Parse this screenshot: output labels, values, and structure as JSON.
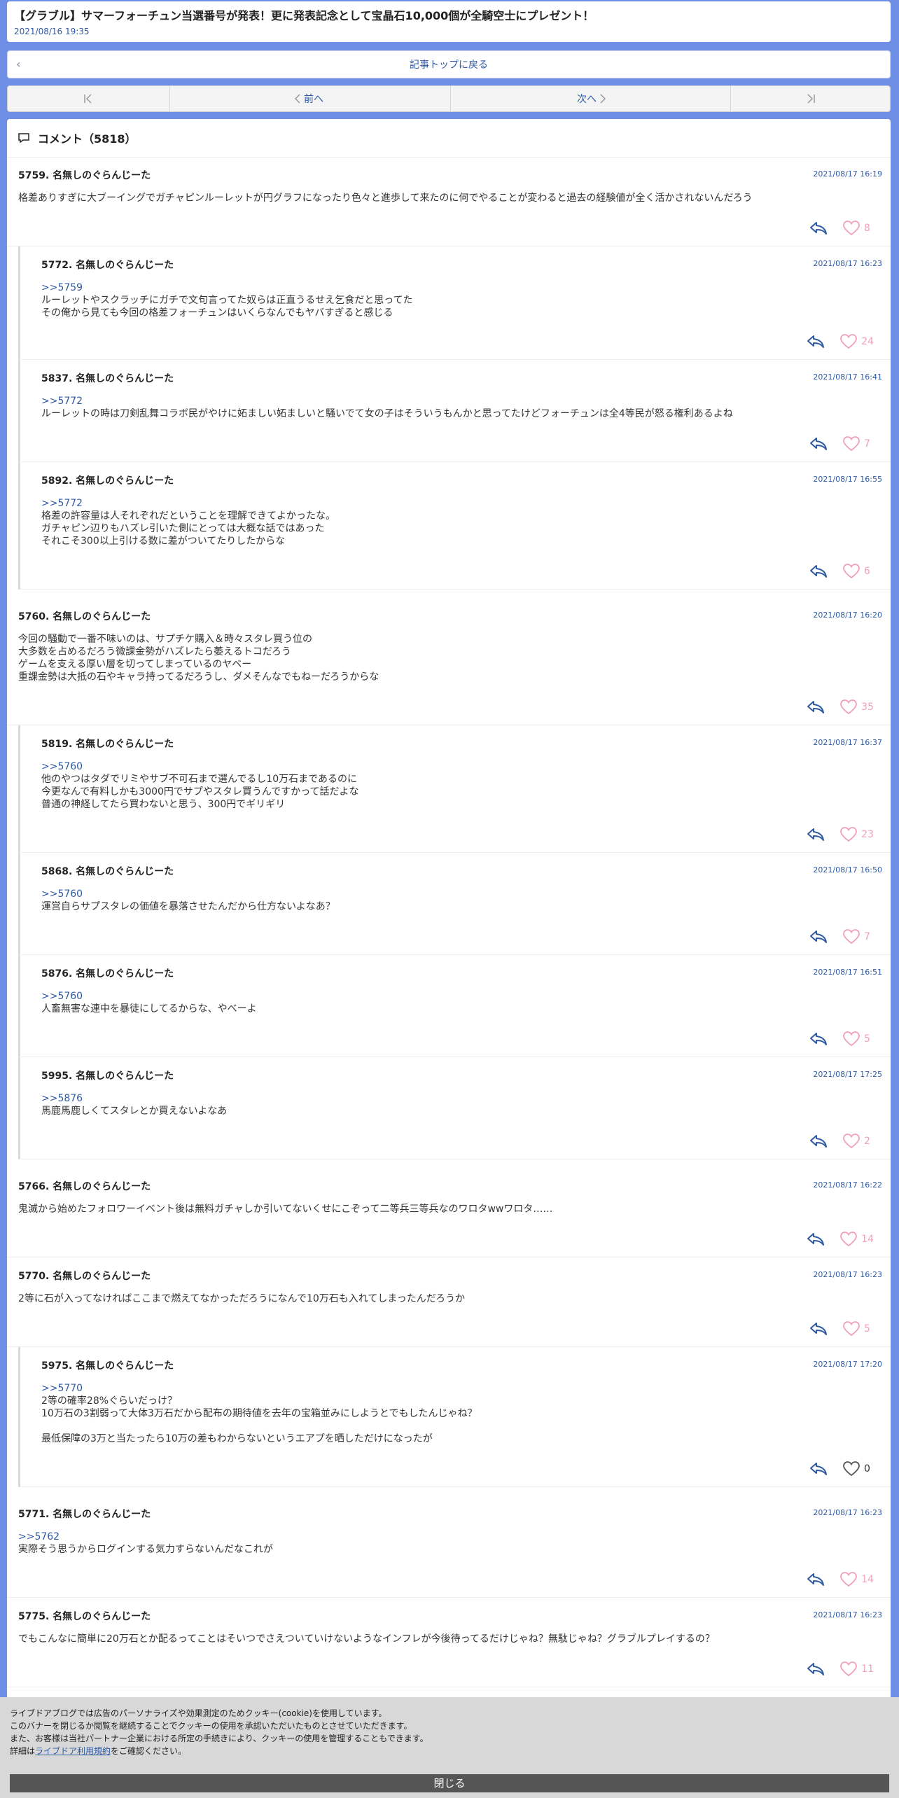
{
  "article": {
    "title": "【グラブル】サマーフォーチュン当選番号が発表！更に発表記念として宝晶石10,000個が全騎空士にプレゼント！",
    "date": "2021/08/16 19:35"
  },
  "back_label": "記事トップに戻る",
  "nav": {
    "prev": "前へ",
    "next": "次へ"
  },
  "comments_header": "コメント（5818）",
  "comments": [
    {
      "num": "5759.",
      "name": "名無しのぐらんじーた",
      "time": "2021/08/17 16:19",
      "anchor": "",
      "body": "格差ありすぎに大ブーイングでガチャピンルーレットが円グラフになったり色々と進歩して来たのに何でやることが変わると過去の経験値が全く活かされないんだろう",
      "likes": "8"
    },
    {
      "num": "5772.",
      "name": "名無しのぐらんじーた",
      "time": "2021/08/17 16:23",
      "anchor": ">>5759",
      "body": "ルーレットやスクラッチにガチで文句言ってた奴らは正直うるせえ乞食だと思ってた\nその俺から見ても今回の格差フォーチュンはいくらなんでもヤバすぎると感じる",
      "likes": "24"
    },
    {
      "num": "5837.",
      "name": "名無しのぐらんじーた",
      "time": "2021/08/17 16:41",
      "anchor": ">>5772",
      "body": "ルーレットの時は刀剣乱舞コラボ民がやけに妬ましい妬ましいと騒いでて女の子はそういうもんかと思ってたけどフォーチュンは全4等民が怒る権利あるよね",
      "likes": "7"
    },
    {
      "num": "5892.",
      "name": "名無しのぐらんじーた",
      "time": "2021/08/17 16:55",
      "anchor": ">>5772",
      "body": "格差の許容量は人それぞれだということを理解できてよかったな。\nガチャピン辺りもハズレ引いた側にとっては大概な話ではあった\nそれこそ300以上引ける数に差がついてたりしたからな",
      "likes": "6"
    },
    {
      "num": "5760.",
      "name": "名無しのぐらんじーた",
      "time": "2021/08/17 16:20",
      "anchor": "",
      "body": "今回の騒動で一番不味いのは、サプチケ購入＆時々スタレ買う位の\n大多数を占めるだろう微課金勢がハズレたら萎えるトコだろう\nゲームを支える厚い層を切ってしまっているのヤベー\n重課金勢は大抵の石やキャラ持ってるだろうし、ダメそんなでもねーだろうからな",
      "likes": "35"
    },
    {
      "num": "5819.",
      "name": "名無しのぐらんじーた",
      "time": "2021/08/17 16:37",
      "anchor": ">>5760",
      "body": "他のやつはタダでリミやサブ不可石まで選んでるし10万石まであるのに\n今更なんで有料しかも3000円でサプやスタレ買うんですかって話だよな\n普通の神経してたら買わないと思う、300円でギリギリ",
      "likes": "23"
    },
    {
      "num": "5868.",
      "name": "名無しのぐらんじーた",
      "time": "2021/08/17 16:50",
      "anchor": ">>5760",
      "body": "運営自らサプスタレの価値を暴落させたんだから仕方ないよなあ？",
      "likes": "7"
    },
    {
      "num": "5876.",
      "name": "名無しのぐらんじーた",
      "time": "2021/08/17 16:51",
      "anchor": ">>5760",
      "body": "人畜無害な連中を暴徒にしてるからな、やべーよ",
      "likes": "5"
    },
    {
      "num": "5995.",
      "name": "名無しのぐらんじーた",
      "time": "2021/08/17 17:25",
      "anchor": ">>5876",
      "body": "馬鹿馬鹿しくてスタレとか買えないよなあ",
      "likes": "2"
    },
    {
      "num": "5766.",
      "name": "名無しのぐらんじーた",
      "time": "2021/08/17 16:22",
      "anchor": "",
      "body": "鬼滅から始めたフォロワーイベント後は無料ガチャしか引いてないくせにこぞって二等兵三等兵なのワロタwwワロタ……",
      "likes": "14"
    },
    {
      "num": "5770.",
      "name": "名無しのぐらんじーた",
      "time": "2021/08/17 16:23",
      "anchor": "",
      "body": "2等に石が入ってなければここまで燃えてなかっただろうになんで10万石も入れてしまったんだろうか",
      "likes": "5"
    },
    {
      "num": "5975.",
      "name": "名無しのぐらんじーた",
      "time": "2021/08/17 17:20",
      "anchor": ">>5770",
      "body": "2等の確率28%ぐらいだっけ？\n10万石の3割弱って大体3万石だから配布の期待値を去年の宝箱並みにしようとでもしたんじゃね？\n\n最低保障の3万と当たったら10万の差もわからないというエアプを晒しただけになったが",
      "likes": "0"
    },
    {
      "num": "5771.",
      "name": "名無しのぐらんじーた",
      "time": "2021/08/17 16:23",
      "anchor": ">>5762",
      "body": "実際そう思うからログインする気力すらないんだなこれが",
      "likes": "14"
    },
    {
      "num": "5775.",
      "name": "名無しのぐらんじーた",
      "time": "2021/08/17 16:23",
      "anchor": "",
      "body": "でもこんなに簡単に20万石とか配るってことはそいつでさえついていけないようなインフレが今後待ってるだけじゃね？無駄じゃね？グラブルプレイするの？",
      "likes": "11"
    }
  ],
  "cookie": {
    "line1": "ライブドアブログでは広告のパーソナライズや効果測定のためクッキー(cookie)を使用しています。",
    "line2": "このバナーを閉じるか閲覧を継続することでクッキーの使用を承認いただいたものとさせていただきます。",
    "line3": "また、お客様は当社パートナー企業における所定の手続きにより、クッキーの使用を管理することもできます。",
    "line4_pre": "詳細は",
    "line4_link": "ライブドア利用規約",
    "line4_post": "をご確認ください。",
    "close": "閉じる"
  },
  "colors": {
    "accent": "#2f5aa3",
    "background": "#6f8fe6",
    "heart": "#f0a0b8"
  }
}
